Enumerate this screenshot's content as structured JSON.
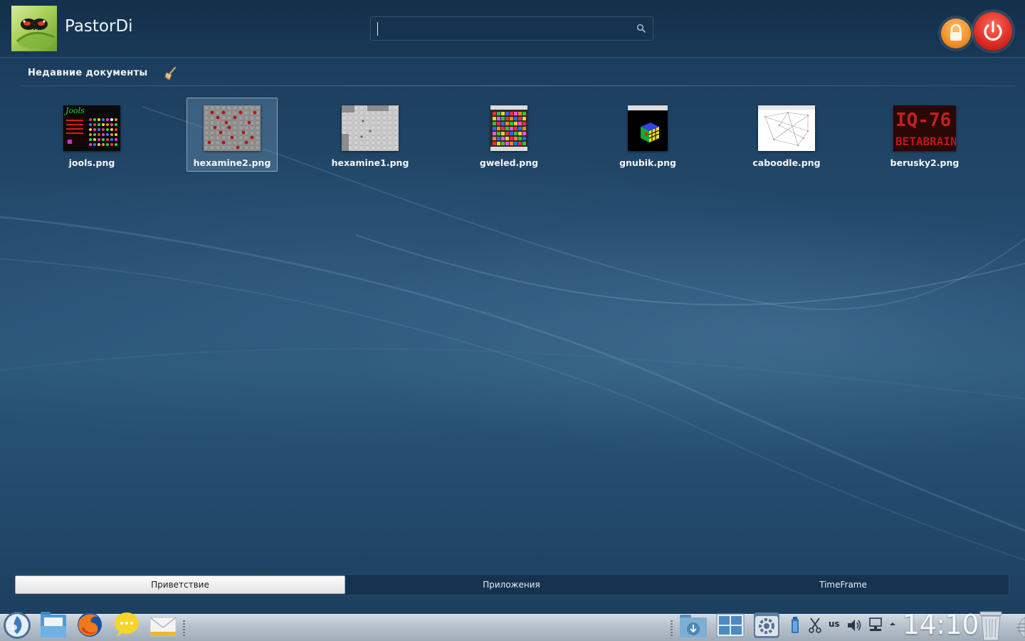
{
  "header": {
    "username": "PastorDi",
    "search": {
      "value": "",
      "placeholder": ""
    },
    "lock_icon": "lock-icon",
    "power_icon": "power-icon"
  },
  "recent": {
    "title": "Недавние документы",
    "clear_icon": "broom-icon",
    "documents": [
      {
        "name": "jools.png",
        "selected": false
      },
      {
        "name": "hexamine2.png",
        "selected": true
      },
      {
        "name": "hexamine1.png",
        "selected": false
      },
      {
        "name": "gweled.png",
        "selected": false
      },
      {
        "name": "gnubik.png",
        "selected": false
      },
      {
        "name": "caboodle.png",
        "selected": false
      },
      {
        "name": "berusky2.png",
        "selected": false
      }
    ]
  },
  "tabs": [
    {
      "label": "Приветствие",
      "active": true
    },
    {
      "label": "Приложения",
      "active": false
    },
    {
      "label": "TimeFrame",
      "active": false
    }
  ],
  "panel": {
    "launchers": [
      "kickoff-icon",
      "file-manager-icon",
      "firefox-icon",
      "chat-icon",
      "mail-icon"
    ],
    "tray": [
      "download-folder-icon",
      "window-list-icon",
      "system-settings-icon",
      "battery-icon",
      "clipboard-icon",
      "volume-icon",
      "network-icon",
      "expand-arrow-icon"
    ],
    "keyboard_layout": "us",
    "clock": "14:10",
    "trash_icon": "trash-icon"
  },
  "colors": {
    "accent": "#1e4262",
    "power": "#dc2b22",
    "lock": "#f1902a"
  }
}
